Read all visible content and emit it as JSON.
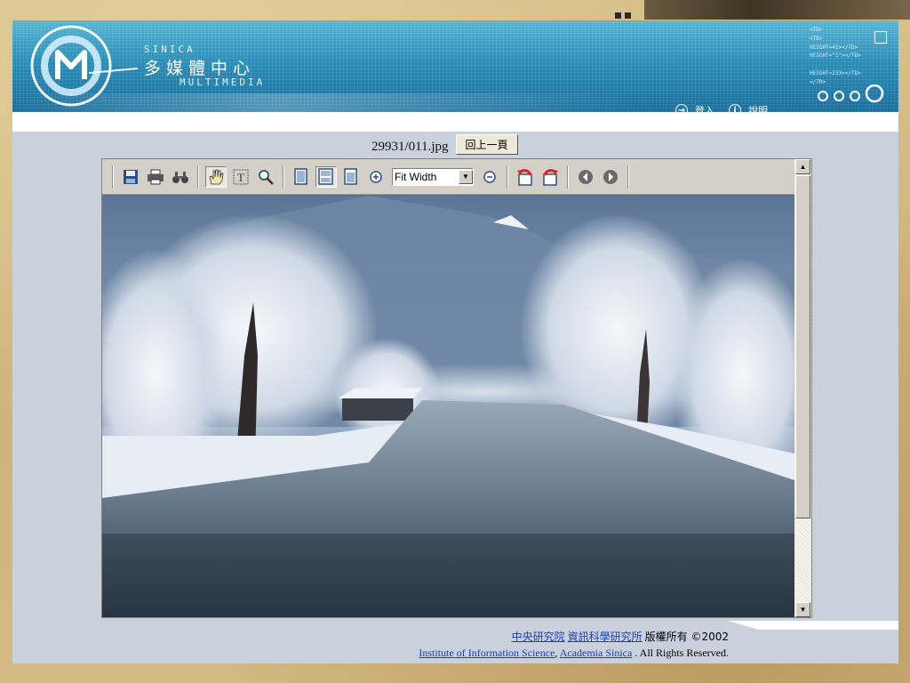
{
  "header": {
    "brand_en": "SINICA",
    "brand_zh": "多媒體中心",
    "brand_sub": "MULTIMEDIA",
    "login_label": "登入",
    "help_label": "說明",
    "code_lines": [
      "<TD>",
      "<TD>",
      "HEIGHT=45></TD>",
      "HEIGHT=\"1\"></TD>",
      "",
      "HEIGHT=233></TD>",
      "</TR>"
    ]
  },
  "viewer": {
    "filename": "29931/011.jpg",
    "back_label": "回上一頁",
    "zoom_value": "Fit Width",
    "image_description": "winter-river-landscape"
  },
  "toolbar": {
    "icons": [
      "save-icon",
      "print-icon",
      "find-icon",
      "hand-tool-icon",
      "text-select-icon",
      "zoom-tool-icon",
      "single-page-icon",
      "continuous-page-icon",
      "facing-page-icon",
      "zoom-in-icon",
      "zoom-out-icon",
      "rotate-left-icon",
      "rotate-right-icon",
      "previous-icon",
      "next-icon"
    ]
  },
  "footer": {
    "link_sinica_zh": "中央研究院",
    "link_iis_zh": "資訊科學研究所",
    "copyright_zh": "版權所有 ©2002",
    "link_iis_en": "Institute of Information Science",
    "sep": ",",
    "link_sinica_en": "Academia Sinica",
    "rights_en": ". All Rights Reserved."
  },
  "colors": {
    "banner": "#2b8eb7",
    "window_bg": "#c9d2dc",
    "link": "#1a3fb8"
  }
}
